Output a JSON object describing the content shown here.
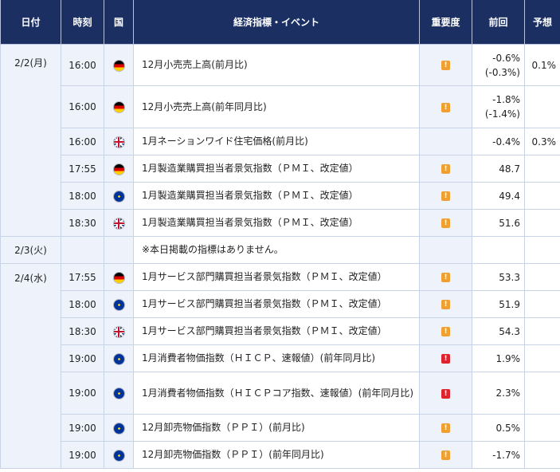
{
  "headers": {
    "date": "日付",
    "time": "時刻",
    "country": "国",
    "event": "経済指標・イベント",
    "importance": "重要度",
    "previous": "前回",
    "forecast": "予想"
  },
  "colors": {
    "header_bg": "#1b2f63",
    "row_shade": "#eef3fb",
    "importance_mid": "#f0a030",
    "importance_high": "#e0222e"
  },
  "rows": [
    {
      "date": "2/2(月)",
      "time": "16:00",
      "country_icon": "germany-flag-icon",
      "event": "12月小売売上高(前月比)",
      "importance_icon": "importance-medium-icon",
      "importance_mark": "!",
      "previous": "-0.6%",
      "previous_revised": "(-0.3%)",
      "forecast": "0.1%"
    },
    {
      "date": "",
      "time": "16:00",
      "country_icon": "germany-flag-icon",
      "event": "12月小売売上高(前年同月比)",
      "importance_icon": "importance-medium-icon",
      "importance_mark": "!",
      "previous": "-1.8%",
      "previous_revised": "(-1.4%)",
      "forecast": ""
    },
    {
      "date": "",
      "time": "16:00",
      "country_icon": "uk-flag-icon",
      "event": "1月ネーションワイド住宅価格(前月比)",
      "importance_icon": "",
      "importance_mark": "",
      "previous": "-0.4%",
      "previous_revised": "",
      "forecast": "0.3%"
    },
    {
      "date": "",
      "time": "17:55",
      "country_icon": "germany-flag-icon",
      "event": "1月製造業購買担当者景気指数（ＰＭＩ、改定値）",
      "importance_icon": "importance-medium-icon",
      "importance_mark": "!",
      "previous": "48.7",
      "previous_revised": "",
      "forecast": ""
    },
    {
      "date": "",
      "time": "18:00",
      "country_icon": "eu-flag-icon",
      "event": "1月製造業購買担当者景気指数（ＰＭＩ、改定値）",
      "importance_icon": "importance-medium-icon",
      "importance_mark": "!",
      "previous": "49.4",
      "previous_revised": "",
      "forecast": ""
    },
    {
      "date": "",
      "time": "18:30",
      "country_icon": "uk-flag-icon",
      "event": "1月製造業購買担当者景気指数（ＰＭＩ、改定値）",
      "importance_icon": "importance-medium-icon",
      "importance_mark": "!",
      "previous": "51.6",
      "previous_revised": "",
      "forecast": ""
    },
    {
      "date": "2/3(火)",
      "time": "",
      "country_icon": "",
      "event": "※本日掲載の指標はありません。",
      "importance_icon": "",
      "importance_mark": "",
      "previous": "",
      "previous_revised": "",
      "forecast": ""
    },
    {
      "date": "2/4(水)",
      "time": "17:55",
      "country_icon": "germany-flag-icon",
      "event": "1月サービス部門購買担当者景気指数（ＰＭＩ、改定値）",
      "importance_icon": "importance-medium-icon",
      "importance_mark": "!",
      "previous": "53.3",
      "previous_revised": "",
      "forecast": ""
    },
    {
      "date": "",
      "time": "18:00",
      "country_icon": "eu-flag-icon",
      "event": "1月サービス部門購買担当者景気指数（ＰＭＩ、改定値）",
      "importance_icon": "importance-medium-icon",
      "importance_mark": "!",
      "previous": "51.9",
      "previous_revised": "",
      "forecast": ""
    },
    {
      "date": "",
      "time": "18:30",
      "country_icon": "uk-flag-icon",
      "event": "1月サービス部門購買担当者景気指数（ＰＭＩ、改定値）",
      "importance_icon": "importance-medium-icon",
      "importance_mark": "!",
      "previous": "54.3",
      "previous_revised": "",
      "forecast": ""
    },
    {
      "date": "",
      "time": "19:00",
      "country_icon": "eu-flag-icon",
      "event": "1月消費者物価指数（ＨＩＣＰ、速報値）(前年同月比)",
      "importance_icon": "importance-high-icon",
      "importance_mark": "!",
      "previous": "1.9%",
      "previous_revised": "",
      "forecast": ""
    },
    {
      "date": "",
      "time": "19:00",
      "country_icon": "eu-flag-icon",
      "event": "1月消費者物価指数（ＨＩＣＰコア指数、速報値）(前年同月比)",
      "importance_icon": "importance-high-icon",
      "importance_mark": "!",
      "previous": "2.3%",
      "previous_revised": "",
      "forecast": ""
    },
    {
      "date": "",
      "time": "19:00",
      "country_icon": "eu-flag-icon",
      "event": "12月卸売物価指数（ＰＰＩ）(前月比)",
      "importance_icon": "importance-medium-icon",
      "importance_mark": "!",
      "previous": "0.5%",
      "previous_revised": "",
      "forecast": ""
    },
    {
      "date": "",
      "time": "19:00",
      "country_icon": "eu-flag-icon",
      "event": "12月卸売物価指数（ＰＰＩ）(前年同月比)",
      "importance_icon": "importance-medium-icon",
      "importance_mark": "!",
      "previous": "-1.7%",
      "previous_revised": "",
      "forecast": ""
    }
  ]
}
